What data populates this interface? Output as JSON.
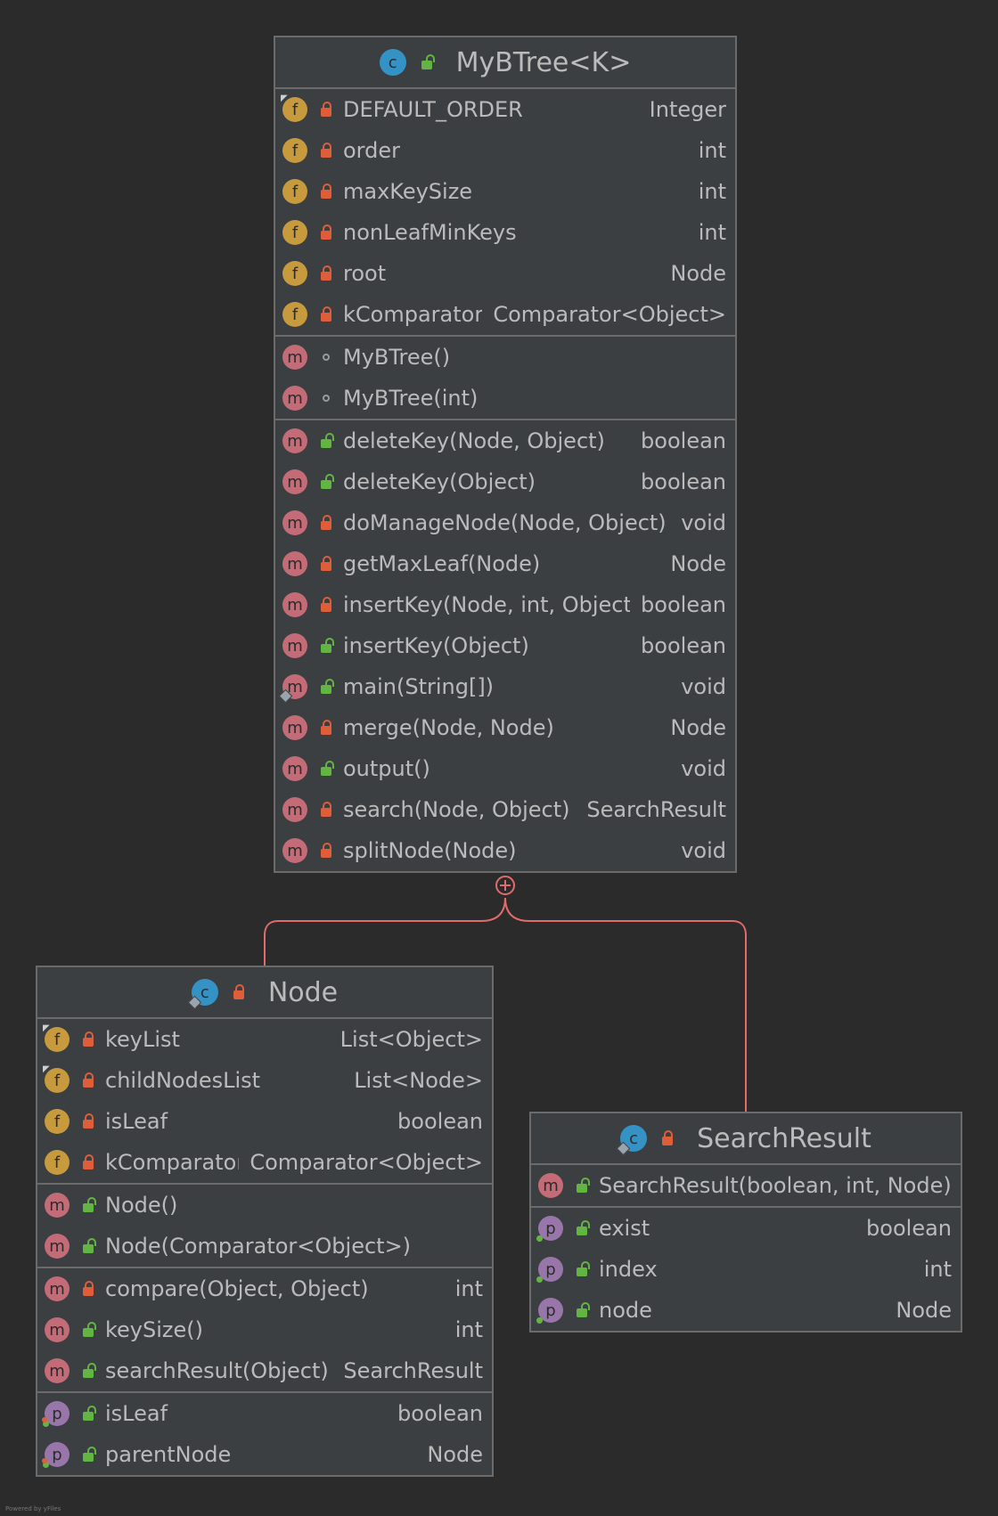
{
  "diagram": {
    "footer": "Powered by yFiles",
    "colors": {
      "background": "#2b2b2b",
      "box": "#3c3f41",
      "border": "#6b6b6b",
      "edge": "#e06c6c",
      "field_icon": "#c79a3e",
      "method_icon": "#c36b76",
      "property_icon": "#9876aa",
      "class_icon": "#3592c4",
      "private_lock": "#e05d3a",
      "public_lock": "#62b543"
    },
    "classes": [
      {
        "id": "mybtree",
        "title": "MyBTree<K>",
        "class_icon": "class-icon",
        "sections": [
          [
            {
              "kind": "f",
              "vis": "private",
              "mark": "final",
              "name": "DEFAULT_ORDER",
              "type": "Integer"
            },
            {
              "kind": "f",
              "vis": "private",
              "name": "order",
              "type": "int"
            },
            {
              "kind": "f",
              "vis": "private",
              "name": "maxKeySize",
              "type": "int"
            },
            {
              "kind": "f",
              "vis": "private",
              "name": "nonLeafMinKeys",
              "type": "int"
            },
            {
              "kind": "f",
              "vis": "private",
              "name": "root",
              "type": "Node"
            },
            {
              "kind": "f",
              "vis": "private",
              "name": "kComparator",
              "type": "Comparator<Object>"
            }
          ],
          [
            {
              "kind": "m",
              "vis": "package",
              "name": "MyBTree()",
              "type": ""
            },
            {
              "kind": "m",
              "vis": "package",
              "name": "MyBTree(int)",
              "type": ""
            }
          ],
          [
            {
              "kind": "m",
              "vis": "public",
              "name": "deleteKey(Node, Object)",
              "type": "boolean"
            },
            {
              "kind": "m",
              "vis": "public",
              "name": "deleteKey(Object)",
              "type": "boolean"
            },
            {
              "kind": "m",
              "vis": "private",
              "name": "doManageNode(Node, Object)",
              "type": "void"
            },
            {
              "kind": "m",
              "vis": "private",
              "name": "getMaxLeaf(Node)",
              "type": "Node"
            },
            {
              "kind": "m",
              "vis": "private",
              "name": "insertKey(Node, int, Object)",
              "type": "boolean"
            },
            {
              "kind": "m",
              "vis": "public",
              "name": "insertKey(Object)",
              "type": "boolean"
            },
            {
              "kind": "m",
              "vis": "public",
              "mark": "static",
              "name": "main(String[])",
              "type": "void"
            },
            {
              "kind": "m",
              "vis": "private",
              "name": "merge(Node, Node)",
              "type": "Node"
            },
            {
              "kind": "m",
              "vis": "public",
              "name": "output()",
              "type": "void"
            },
            {
              "kind": "m",
              "vis": "private",
              "name": "search(Node, Object)",
              "type": "SearchResult"
            },
            {
              "kind": "m",
              "vis": "private",
              "name": "splitNode(Node)",
              "type": "void"
            }
          ]
        ]
      },
      {
        "id": "node",
        "title": "Node",
        "class_icon": "inner-class-icon",
        "title_vis": "private",
        "sections": [
          [
            {
              "kind": "f",
              "vis": "private",
              "mark": "final",
              "name": "keyList",
              "type": "List<Object>"
            },
            {
              "kind": "f",
              "vis": "private",
              "mark": "final",
              "name": "childNodesList",
              "type": "List<Node>"
            },
            {
              "kind": "f",
              "vis": "private",
              "name": "isLeaf",
              "type": "boolean"
            },
            {
              "kind": "f",
              "vis": "private",
              "name": "kComparator",
              "type": "Comparator<Object>"
            }
          ],
          [
            {
              "kind": "m",
              "vis": "public",
              "name": "Node()",
              "type": ""
            },
            {
              "kind": "m",
              "vis": "public",
              "name": "Node(Comparator<Object>)",
              "type": ""
            }
          ],
          [
            {
              "kind": "m",
              "vis": "private",
              "name": "compare(Object, Object)",
              "type": "int"
            },
            {
              "kind": "m",
              "vis": "public",
              "name": "keySize()",
              "type": "int"
            },
            {
              "kind": "m",
              "vis": "public",
              "name": "searchResult(Object)",
              "type": "SearchResult"
            }
          ],
          [
            {
              "kind": "p",
              "vis": "public",
              "mark": "rw",
              "name": "isLeaf",
              "type": "boolean"
            },
            {
              "kind": "p",
              "vis": "public",
              "mark": "rw",
              "name": "parentNode",
              "type": "Node"
            }
          ]
        ]
      },
      {
        "id": "searchresult",
        "title": "SearchResult",
        "class_icon": "inner-class-icon",
        "title_vis": "private",
        "sections": [
          [
            {
              "kind": "m",
              "vis": "public",
              "name": "SearchResult(boolean, int, Node)",
              "type": ""
            }
          ],
          [
            {
              "kind": "p",
              "vis": "public",
              "mark": "r",
              "name": "exist",
              "type": "boolean"
            },
            {
              "kind": "p",
              "vis": "public",
              "mark": "r",
              "name": "index",
              "type": "int"
            },
            {
              "kind": "p",
              "vis": "public",
              "mark": "r",
              "name": "node",
              "type": "Node"
            }
          ]
        ]
      }
    ],
    "edges": [
      {
        "from": "mybtree",
        "to": "node",
        "kind": "inner-class"
      },
      {
        "from": "mybtree",
        "to": "searchresult",
        "kind": "inner-class"
      }
    ]
  }
}
